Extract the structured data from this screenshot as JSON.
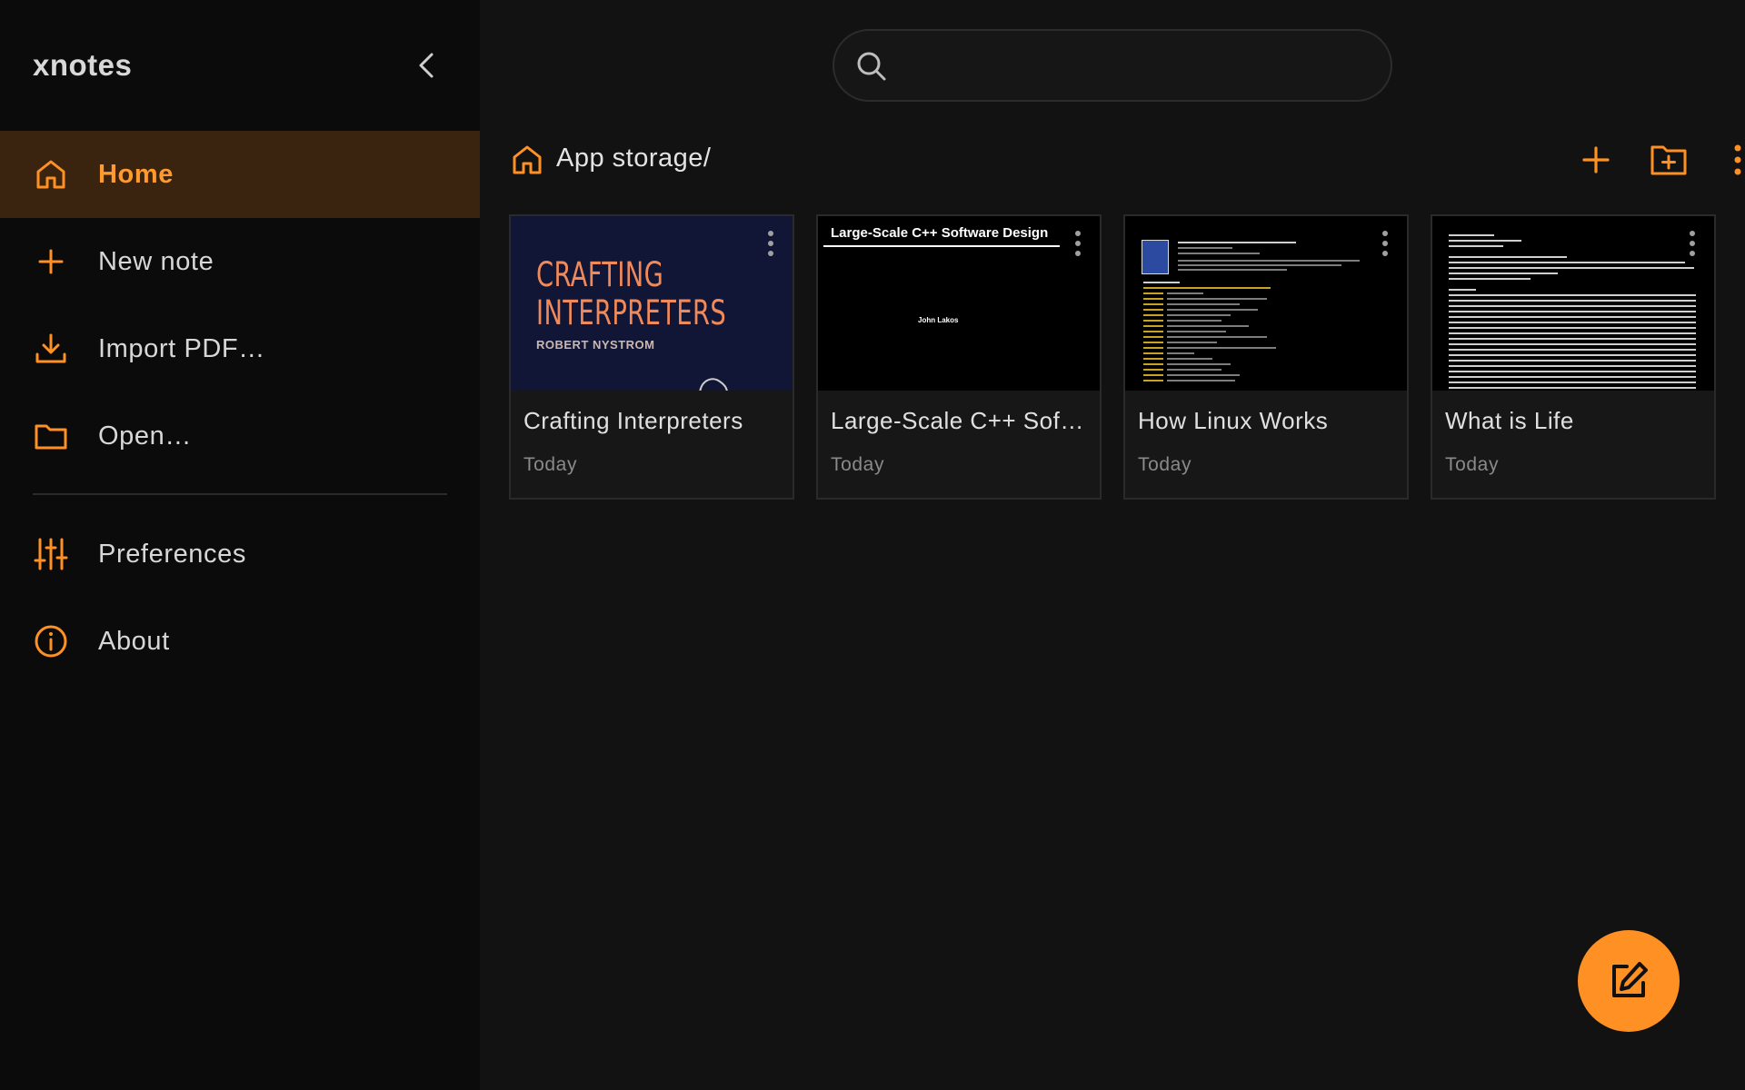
{
  "app": {
    "title": "xnotes",
    "accent": "#ff9124"
  },
  "sidebar": {
    "items": [
      {
        "label": "Home",
        "icon": "home-icon",
        "active": true
      },
      {
        "label": "New note",
        "icon": "plus-icon"
      },
      {
        "label": "Import PDF…",
        "icon": "download-icon"
      },
      {
        "label": "Open…",
        "icon": "folder-icon"
      },
      {
        "label": "Preferences",
        "icon": "sliders-icon"
      },
      {
        "label": "About",
        "icon": "info-icon"
      }
    ]
  },
  "search": {
    "placeholder": "",
    "value": ""
  },
  "breadcrumb": {
    "path": "App storage/"
  },
  "toolbar": {
    "add": "plus-icon",
    "new_folder": "folder-plus-icon",
    "more": "more-vert-icon"
  },
  "notes": [
    {
      "title": "Crafting Interpreters",
      "date": "Today",
      "thumb": {
        "line1": "CRAFTING",
        "line2": "INTERPRETERS",
        "author": "ROBERT NYSTROM"
      }
    },
    {
      "title": "Large-Scale C++ Soft…",
      "date": "Today",
      "thumb": {
        "heading": "Large-Scale C++ Software Design",
        "author": "John Lakos"
      }
    },
    {
      "title": "How Linux Works",
      "date": "Today"
    },
    {
      "title": "What is Life",
      "date": "Today"
    }
  ],
  "fab": {
    "icon": "edit-icon"
  }
}
